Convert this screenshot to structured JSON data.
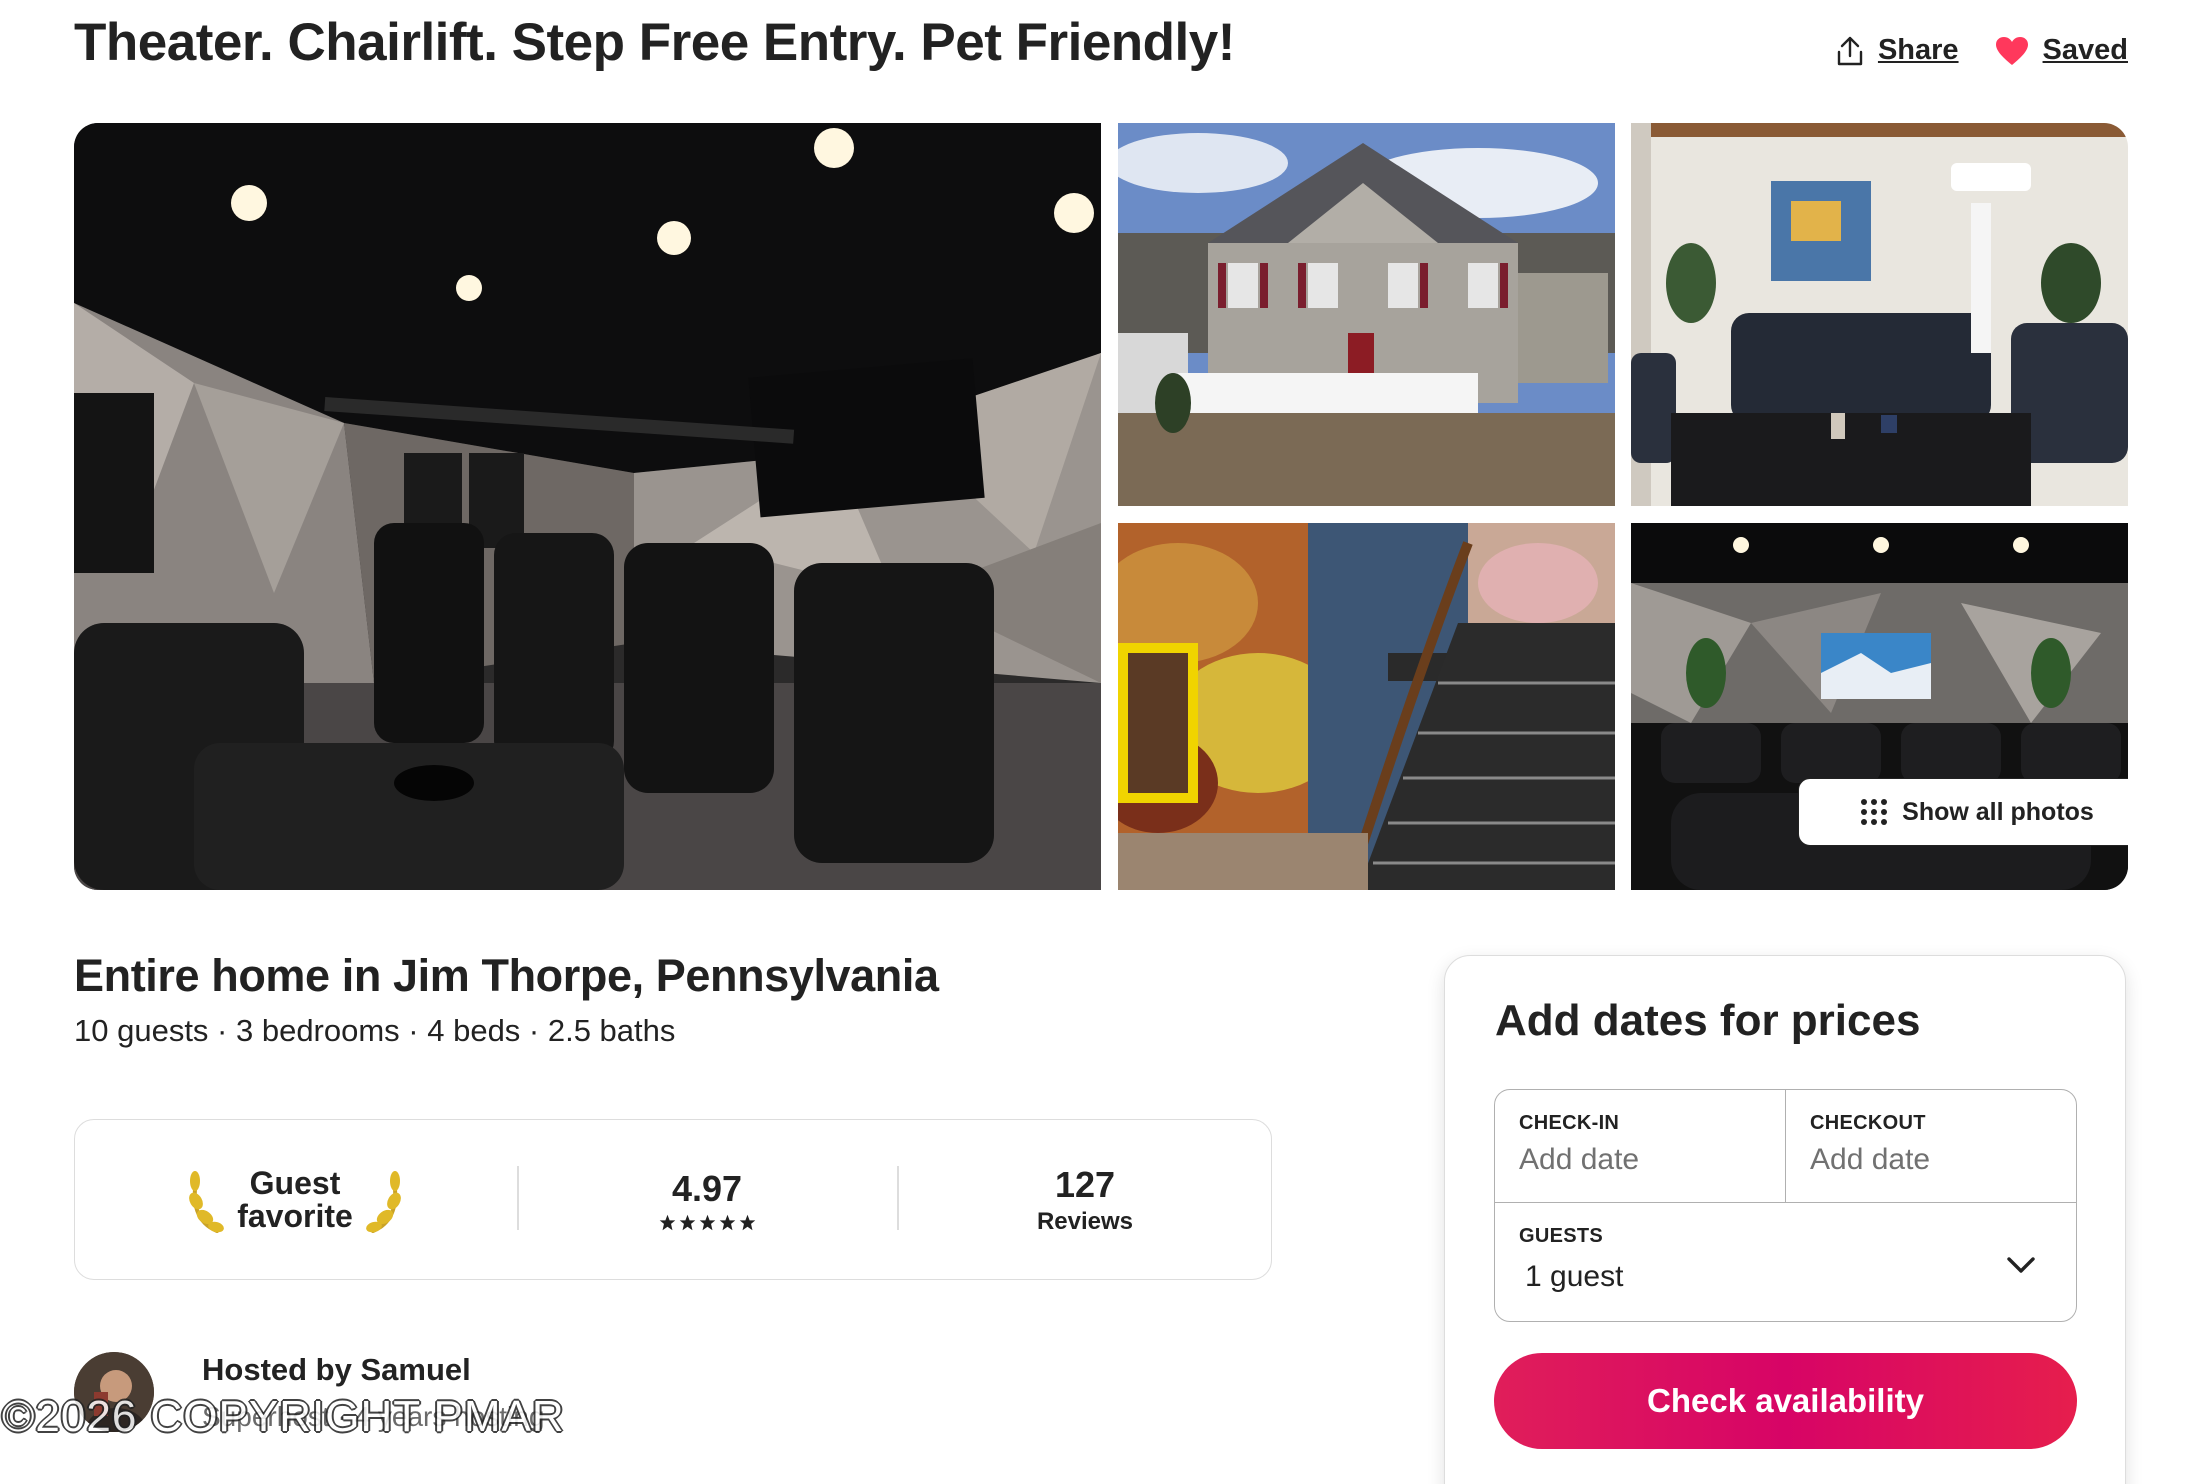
{
  "listing": {
    "title": "Theater. Chairlift. Step Free Entry. Pet Friendly!",
    "share_label": "Share",
    "saved_label": "Saved",
    "subtitle": "Entire home in Jim Thorpe, Pennsylvania",
    "details": "10 guests · 3 bedrooms · 4 beds · 2.5 baths"
  },
  "gallery": {
    "show_all_label": "Show all photos"
  },
  "guest_favorite": {
    "badge_line1": "Guest",
    "badge_line2": "favorite",
    "rating": "4.97",
    "reviews_count": "127",
    "reviews_label": "Reviews"
  },
  "host": {
    "name": "Hosted by Samuel",
    "subtitle": "Superhost · 4 years hosting"
  },
  "watermark": "©2026 COPYRIGHT PMAR",
  "booking": {
    "title": "Add dates for prices",
    "checkin_label": "CHECK-IN",
    "checkin_value": "Add date",
    "checkout_label": "CHECKOUT",
    "checkout_value": "Add date",
    "guests_label": "GUESTS",
    "guests_value": "1 guest",
    "button_label": "Check availability"
  },
  "colors": {
    "brand": "#E01E5A",
    "heart": "#FF385C",
    "text": "#222222",
    "muted": "#717171"
  }
}
